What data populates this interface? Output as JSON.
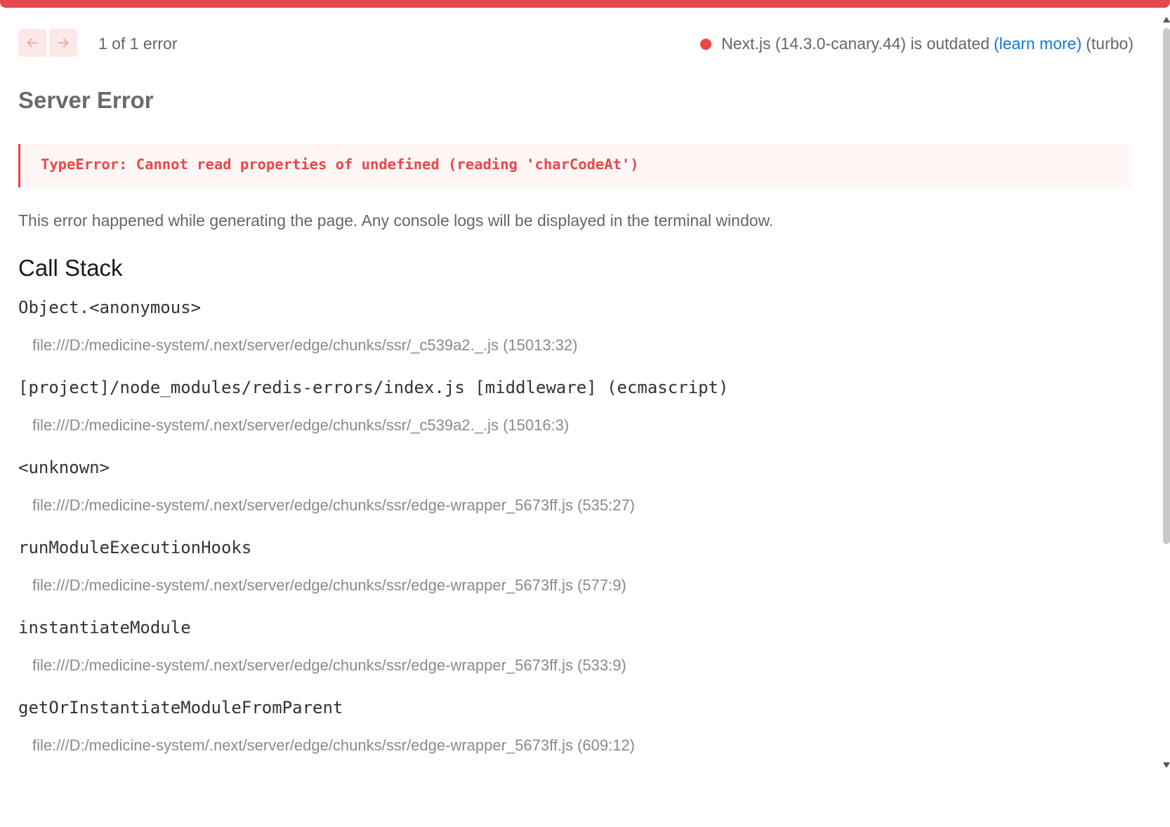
{
  "header": {
    "error_count": "1 of 1 error",
    "version_prefix": "Next.js (14.3.0-canary.44) is outdated",
    "learn_more": "(learn more)",
    "bundler": "(turbo)"
  },
  "title": "Server Error",
  "error_message": "TypeError: Cannot read properties of undefined (reading 'charCodeAt')",
  "description": "This error happened while generating the page. Any console logs will be displayed in the terminal window.",
  "stack_title": "Call Stack",
  "frames": [
    {
      "fn": "Object.<anonymous>",
      "file": "file:///D:/medicine-system/.next/server/edge/chunks/ssr/_c539a2._.js (15013:32)"
    },
    {
      "fn": "[project]/node_modules/redis-errors/index.js [middleware] (ecmascript)",
      "file": "file:///D:/medicine-system/.next/server/edge/chunks/ssr/_c539a2._.js (15016:3)"
    },
    {
      "fn": "<unknown>",
      "file": "file:///D:/medicine-system/.next/server/edge/chunks/ssr/edge-wrapper_5673ff.js (535:27)"
    },
    {
      "fn": "runModuleExecutionHooks",
      "file": "file:///D:/medicine-system/.next/server/edge/chunks/ssr/edge-wrapper_5673ff.js (577:9)"
    },
    {
      "fn": "instantiateModule",
      "file": "file:///D:/medicine-system/.next/server/edge/chunks/ssr/edge-wrapper_5673ff.js (533:9)"
    },
    {
      "fn": "getOrInstantiateModuleFromParent",
      "file": "file:///D:/medicine-system/.next/server/edge/chunks/ssr/edge-wrapper_5673ff.js (609:12)"
    }
  ],
  "colors": {
    "accent": "#e5484d",
    "error_text": "#f04545",
    "link": "#1577d6"
  },
  "icons": {
    "prev": "arrow-left-icon",
    "next": "arrow-right-icon"
  }
}
